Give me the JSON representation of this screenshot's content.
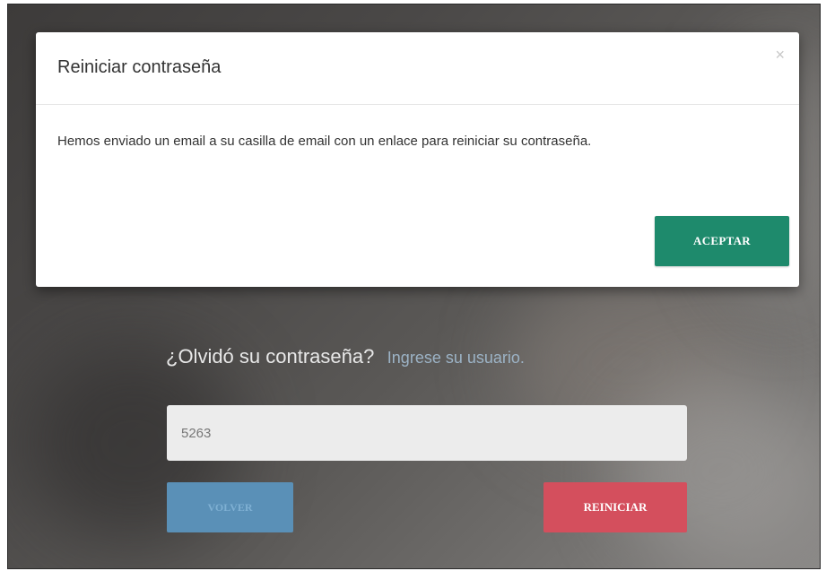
{
  "modal": {
    "title": "Reiniciar contraseña",
    "close_symbol": "×",
    "message": "Hemos enviado un email a su casilla de email con un enlace para reiniciar su contraseña.",
    "accept_label": "ACEPTAR"
  },
  "form": {
    "title": "¿Olvidó su contraseña?",
    "subtitle": "Ingrese su usuario.",
    "username_value": "5263",
    "back_label": "VOLVER",
    "reset_label": "REINICIAR"
  },
  "colors": {
    "accept": "#1e8a6c",
    "back": "#5a90b7",
    "reset": "#d44f5d"
  }
}
